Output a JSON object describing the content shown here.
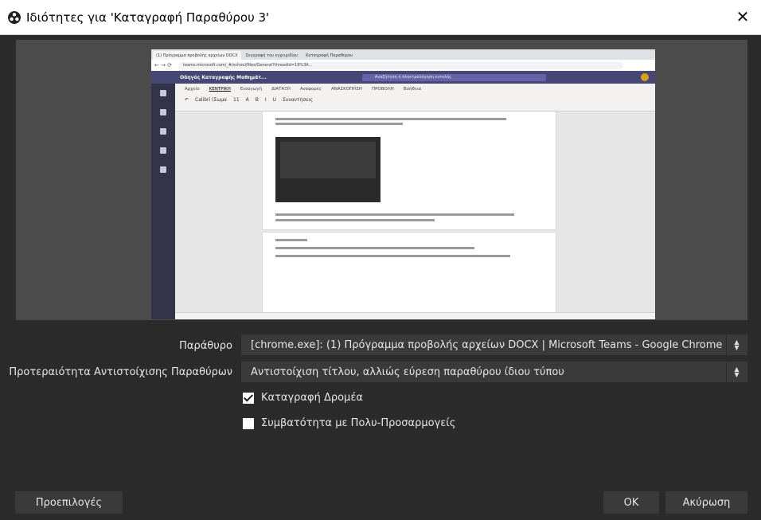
{
  "window": {
    "title": "Ιδιότητες για 'Καταγραφή Παραθύρου 3'",
    "close_glyph": "✕"
  },
  "preview": {
    "browser_tabs": [
      "(1) Πρόγραμμα προβολής αρχείων DOCX",
      "Συγγραφή του εγχειριδίου",
      "Καταγραφή Παραθύρου"
    ],
    "url": "teams.microsoft.com/_#/school/files/General?threadId=19%3A...",
    "teams_title": "Οδηγός Καταγραφής Μαθημάτ...",
    "teams_search": "Αναζήτηση ή πληκτρολόγηση εντολής",
    "ribbon_tabs": [
      "Αρχείο",
      "ΚΕΝΤΡΙΚΗ",
      "Εισαγωγή",
      "ΔΙΑΤΑΞΗ",
      "Αναφορές",
      "ΑΝΑΣΚΟΠΗΣΗ",
      "ΠΡΟΒΟΛΗ",
      "Βοήθεια"
    ],
    "ribbon_tools": [
      "↶",
      "Calibri (Σωμα",
      "11",
      "A",
      "B",
      "I",
      "U",
      "Συναντήσεις"
    ]
  },
  "form": {
    "window_label": "Παράθυρο",
    "window_value": "[chrome.exe]: (1) Πρόγραμμα προβολής αρχείων DOCX | Microsoft Teams - Google Chrome",
    "priority_label": "Προτεραιότητα Αντιστοίχισης Παραθύρων",
    "priority_value": "Αντιστοίχιση τίτλου, αλλιώς εύρεση παραθύρου ίδιου τύπου",
    "capture_cursor_label": "Καταγραφή Δρομέα",
    "capture_cursor_checked": true,
    "multi_adapter_label": "Συμβατότητα με Πολυ-Προσαρμογείς",
    "multi_adapter_checked": false
  },
  "buttons": {
    "defaults": "Προεπιλογές",
    "ok": "OK",
    "cancel": "Ακύρωση"
  },
  "colors": {
    "background": "#2b2b2b",
    "control": "#3a3a3a",
    "preview_bg": "#4b4b4b",
    "teams_purple": "#464775"
  }
}
